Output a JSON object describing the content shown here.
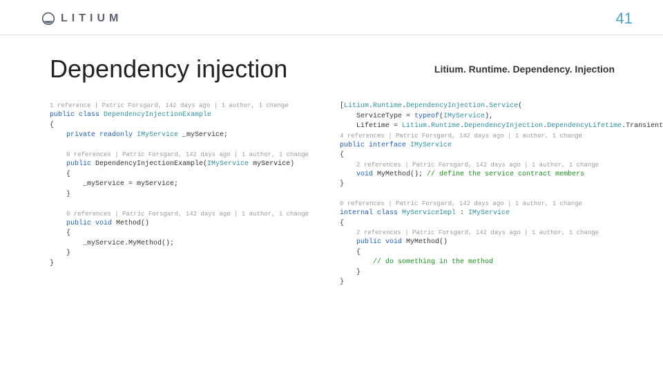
{
  "header": {
    "brand": "LITIUM",
    "page_number": "41"
  },
  "title_row": {
    "slide_title": "Dependency injection",
    "namespace_label": "Litium. Runtime. Dependency. Injection"
  },
  "left_code": {
    "lens1": "1 reference | Patric Forsgard, 142 days ago | 1 author, 1 change",
    "l1_kw1": "public class",
    "l1_type": " DependencyInjectionExample",
    "l2": "{",
    "l3_kw1": "private readonly",
    "l3_type": " IMyService",
    "l3_rest": " _myService;",
    "lens2": "0 references | Patric Forsgard, 142 days ago | 1 author, 1 change",
    "l4_kw1": "public",
    "l4_rest1": " DependencyInjectionExample(",
    "l4_type": "IMyService",
    "l4_rest2": " myService)",
    "l5": "{",
    "l6": "_myService = myService;",
    "l7": "}",
    "lens3": "0 references | Patric Forsgard, 142 days ago | 1 author, 1 change",
    "l8_kw1": "public void",
    "l8_rest": " Method()",
    "l9": "{",
    "l10": "_myService.MyMethod();",
    "l11": "}",
    "l12": "}"
  },
  "right_code": {
    "l1a": "[",
    "l1_type1": "Litium",
    "l1b": ".",
    "l1_type2": "Runtime",
    "l1c": ".",
    "l1_type3": "DependencyInjection",
    "l1d": ".",
    "l1_type4": "Service",
    "l1e": "(",
    "l2a": "ServiceType = ",
    "l2_kw": "typeof",
    "l2b": "(",
    "l2_type": "IMyService",
    "l2c": "),",
    "l3a": "Lifetime = ",
    "l3_type1": "Litium",
    "l3b": ".",
    "l3_type2": "Runtime",
    "l3c": ".",
    "l3_type3": "DependencyInjection",
    "l3d": ".",
    "l3_type4": "DependencyLifetime",
    "l3e": ".Transient)]",
    "lens1": "4 references | Patric Forsgard, 142 days ago | 1 author, 1 change",
    "l4_kw": "public interface",
    "l4_type": " IMyService",
    "l5": "{",
    "lens2": "2 references | Patric Forsgard, 142 days ago | 1 author, 1 change",
    "l6_kw": "void",
    "l6_rest": " MyMethod(); ",
    "l6_comment": "// define the service contract members",
    "l7": "}",
    "lens3": "0 references | Patric Forsgard, 142 days ago | 1 author, 1 change",
    "l8_kw": "internal class",
    "l8_type1": " MyServiceImpl",
    "l8_rest": " : ",
    "l8_type2": "IMyService",
    "l9": "{",
    "lens4": "2 references | Patric Forsgard, 142 days ago | 1 author, 1 change",
    "l10_kw": "public void",
    "l10_rest": " MyMethod()",
    "l11": "{",
    "l12_comment": "// do something in the method",
    "l13": "}",
    "l14": "}"
  }
}
